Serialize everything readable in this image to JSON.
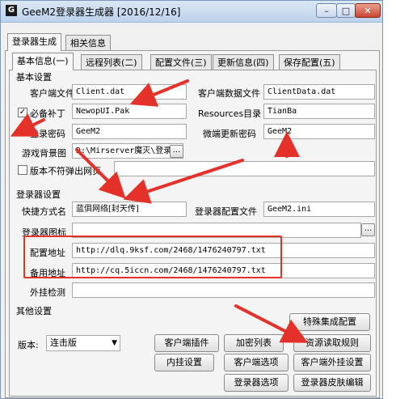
{
  "window": {
    "title": "GeeM2登录器生成器 [2016/12/16]",
    "app_icon_glyph": "G",
    "min_glyph": "–",
    "max_glyph": "□",
    "close_glyph": "✕"
  },
  "top_tabs": [
    "登录器生成",
    "相关信息"
  ],
  "sub_tabs": [
    "基本信息(一)",
    "远程列表(二)",
    "配置文件(三)",
    "更新信息(四)",
    "保存配置(五)"
  ],
  "basic": {
    "group_title": "基本设置",
    "client_file_label": "客户端文件",
    "client_file_value": "Client.dat",
    "client_data_label": "客户端数据文件",
    "client_data_value": "ClientData.dat",
    "patch_label": "必备补丁",
    "patch_value": "NewopUI.Pak",
    "resources_label": "Resources目录",
    "resources_value": "TianBa",
    "password_label": "登录密码",
    "password_value": "GeeM2",
    "micro_update_label": "微端更新密码",
    "micro_update_value": "GeeM2",
    "bg_label": "游戏背景图",
    "bg_value": "D:\\Mirserver魔灭\\登录",
    "browse_glyph": "...",
    "version_mismatch_label": "版本不符弹出网页"
  },
  "login": {
    "group_title": "登录器设置",
    "shortcut_label": "快捷方式名",
    "shortcut_value": "蓝俱网络[封天传]",
    "config_file_label": "登录器配置文件",
    "config_file_value": "GeeM2.ini",
    "icon_label": "登录器图标",
    "browse_glyph": "...",
    "config_url_label": "配置地址",
    "config_url_value": "http://dlq.9ksf.com/2468/1476240797.txt",
    "backup_url_label": "备用地址",
    "backup_url_value": "http://cq.5iccn.com/2468/1476240797.txt",
    "cheat_detect_label": "外挂检测"
  },
  "other": {
    "group_title": "其他设置",
    "version_label": "版本:",
    "version_value": "连击版",
    "buttons": {
      "special": "特殊集成配置",
      "client_plugin": "客户端插件",
      "encrypt_list": "加密列表",
      "resource_rule": "资源读取规则",
      "inner_plugin": "内挂设置",
      "client_options": "客户端选项",
      "client_cheat": "客户端外挂设置",
      "login_options": "登录器选项",
      "login_skin": "登录器皮肤编辑"
    }
  },
  "colors": {
    "annotation_red": "#e4322b",
    "title_gradient_top": "#dbe7f5"
  }
}
